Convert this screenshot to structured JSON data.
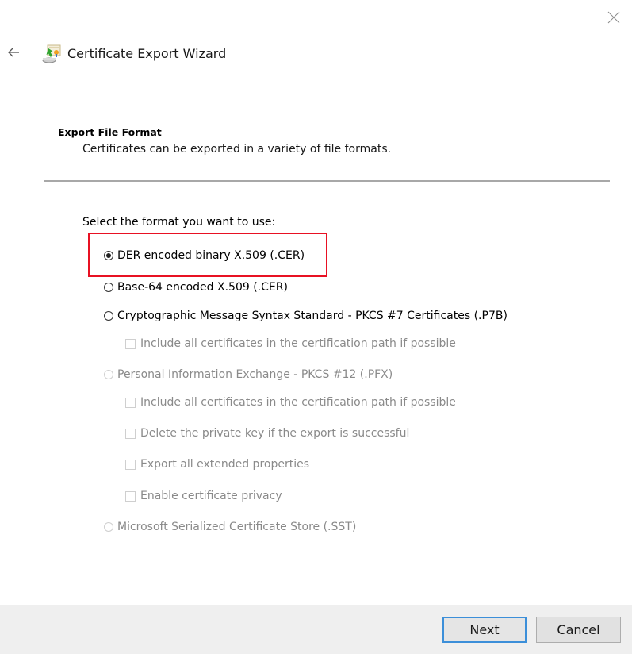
{
  "window": {
    "title": "Certificate Export Wizard",
    "close_icon": "close-icon",
    "back_icon": "back-arrow-icon",
    "wizard_icon": "certificate-export-icon"
  },
  "header": {
    "heading": "Export File Format",
    "subheading": "Certificates can be exported in a variety of file formats."
  },
  "main": {
    "select_label": "Select the format you want to use:",
    "highlight_color": "#e81123",
    "options": [
      {
        "label": "DER encoded binary X.509 (.CER)",
        "type": "radio",
        "checked": true,
        "enabled": true
      },
      {
        "label": "Base-64 encoded X.509 (.CER)",
        "type": "radio",
        "checked": false,
        "enabled": true
      },
      {
        "label": "Cryptographic Message Syntax Standard - PKCS #7 Certificates (.P7B)",
        "type": "radio",
        "checked": false,
        "enabled": true
      },
      {
        "label": "Include all certificates in the certification path if possible",
        "type": "checkbox",
        "checked": false,
        "enabled": false
      },
      {
        "label": "Personal Information Exchange - PKCS #12 (.PFX)",
        "type": "radio",
        "checked": false,
        "enabled": false
      },
      {
        "label": "Include all certificates in the certification path if possible",
        "type": "checkbox",
        "checked": false,
        "enabled": false
      },
      {
        "label": "Delete the private key if the export is successful",
        "type": "checkbox",
        "checked": false,
        "enabled": false
      },
      {
        "label": "Export all extended properties",
        "type": "checkbox",
        "checked": false,
        "enabled": false
      },
      {
        "label": "Enable certificate privacy",
        "type": "checkbox",
        "checked": false,
        "enabled": false
      },
      {
        "label": "Microsoft Serialized Certificate Store (.SST)",
        "type": "radio",
        "checked": false,
        "enabled": false
      }
    ]
  },
  "footer": {
    "next_label": "Next",
    "cancel_label": "Cancel",
    "default_button_border": "#3c8fd9"
  }
}
